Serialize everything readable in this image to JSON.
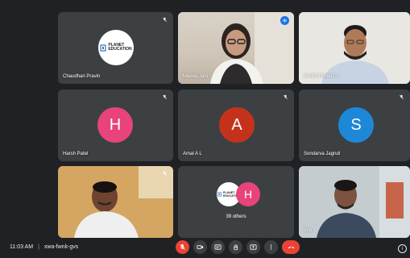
{
  "participants": [
    {
      "name": "Chaudhari Pravin",
      "kind": "logo",
      "mic": "muted",
      "logo_text": [
        "PLANET",
        "EDUCATION"
      ]
    },
    {
      "name": "Mamta Jani",
      "kind": "video",
      "mic": "speaking"
    },
    {
      "name": "SAROJ BHARTI",
      "kind": "video",
      "mic": "none"
    },
    {
      "name": "Harsh Patel",
      "kind": "avatar",
      "initial": "H",
      "color": "#e8437a",
      "mic": "muted"
    },
    {
      "name": "Amal A L",
      "kind": "avatar",
      "initial": "A",
      "color": "#c5321b",
      "mic": "muted"
    },
    {
      "name": "Sondarva Jagruti",
      "kind": "avatar",
      "initial": "S",
      "color": "#1e88d8",
      "mic": "muted"
    },
    {
      "name": "",
      "kind": "video",
      "mic": "muted"
    },
    {
      "name": "You",
      "kind": "video",
      "mic": "none"
    }
  ],
  "others_tile": {
    "label": "39 others",
    "logo_text": [
      "PLANET",
      "EDUCATION"
    ],
    "initial": "H",
    "color": "#e8437a"
  },
  "footer": {
    "time": "11:03 AM",
    "separator": "|",
    "meeting_code": "xwa-fwnk-gvs"
  },
  "controls": [
    "mic-off-icon",
    "camera-icon",
    "captions-icon",
    "raise-hand-icon",
    "present-icon",
    "more-options-icon",
    "end-call-icon"
  ],
  "info_icon": "i",
  "colors": {
    "background": "#202124",
    "tile": "#3c4043",
    "accent_blue": "#1a73e8",
    "end_red": "#ea4335"
  }
}
